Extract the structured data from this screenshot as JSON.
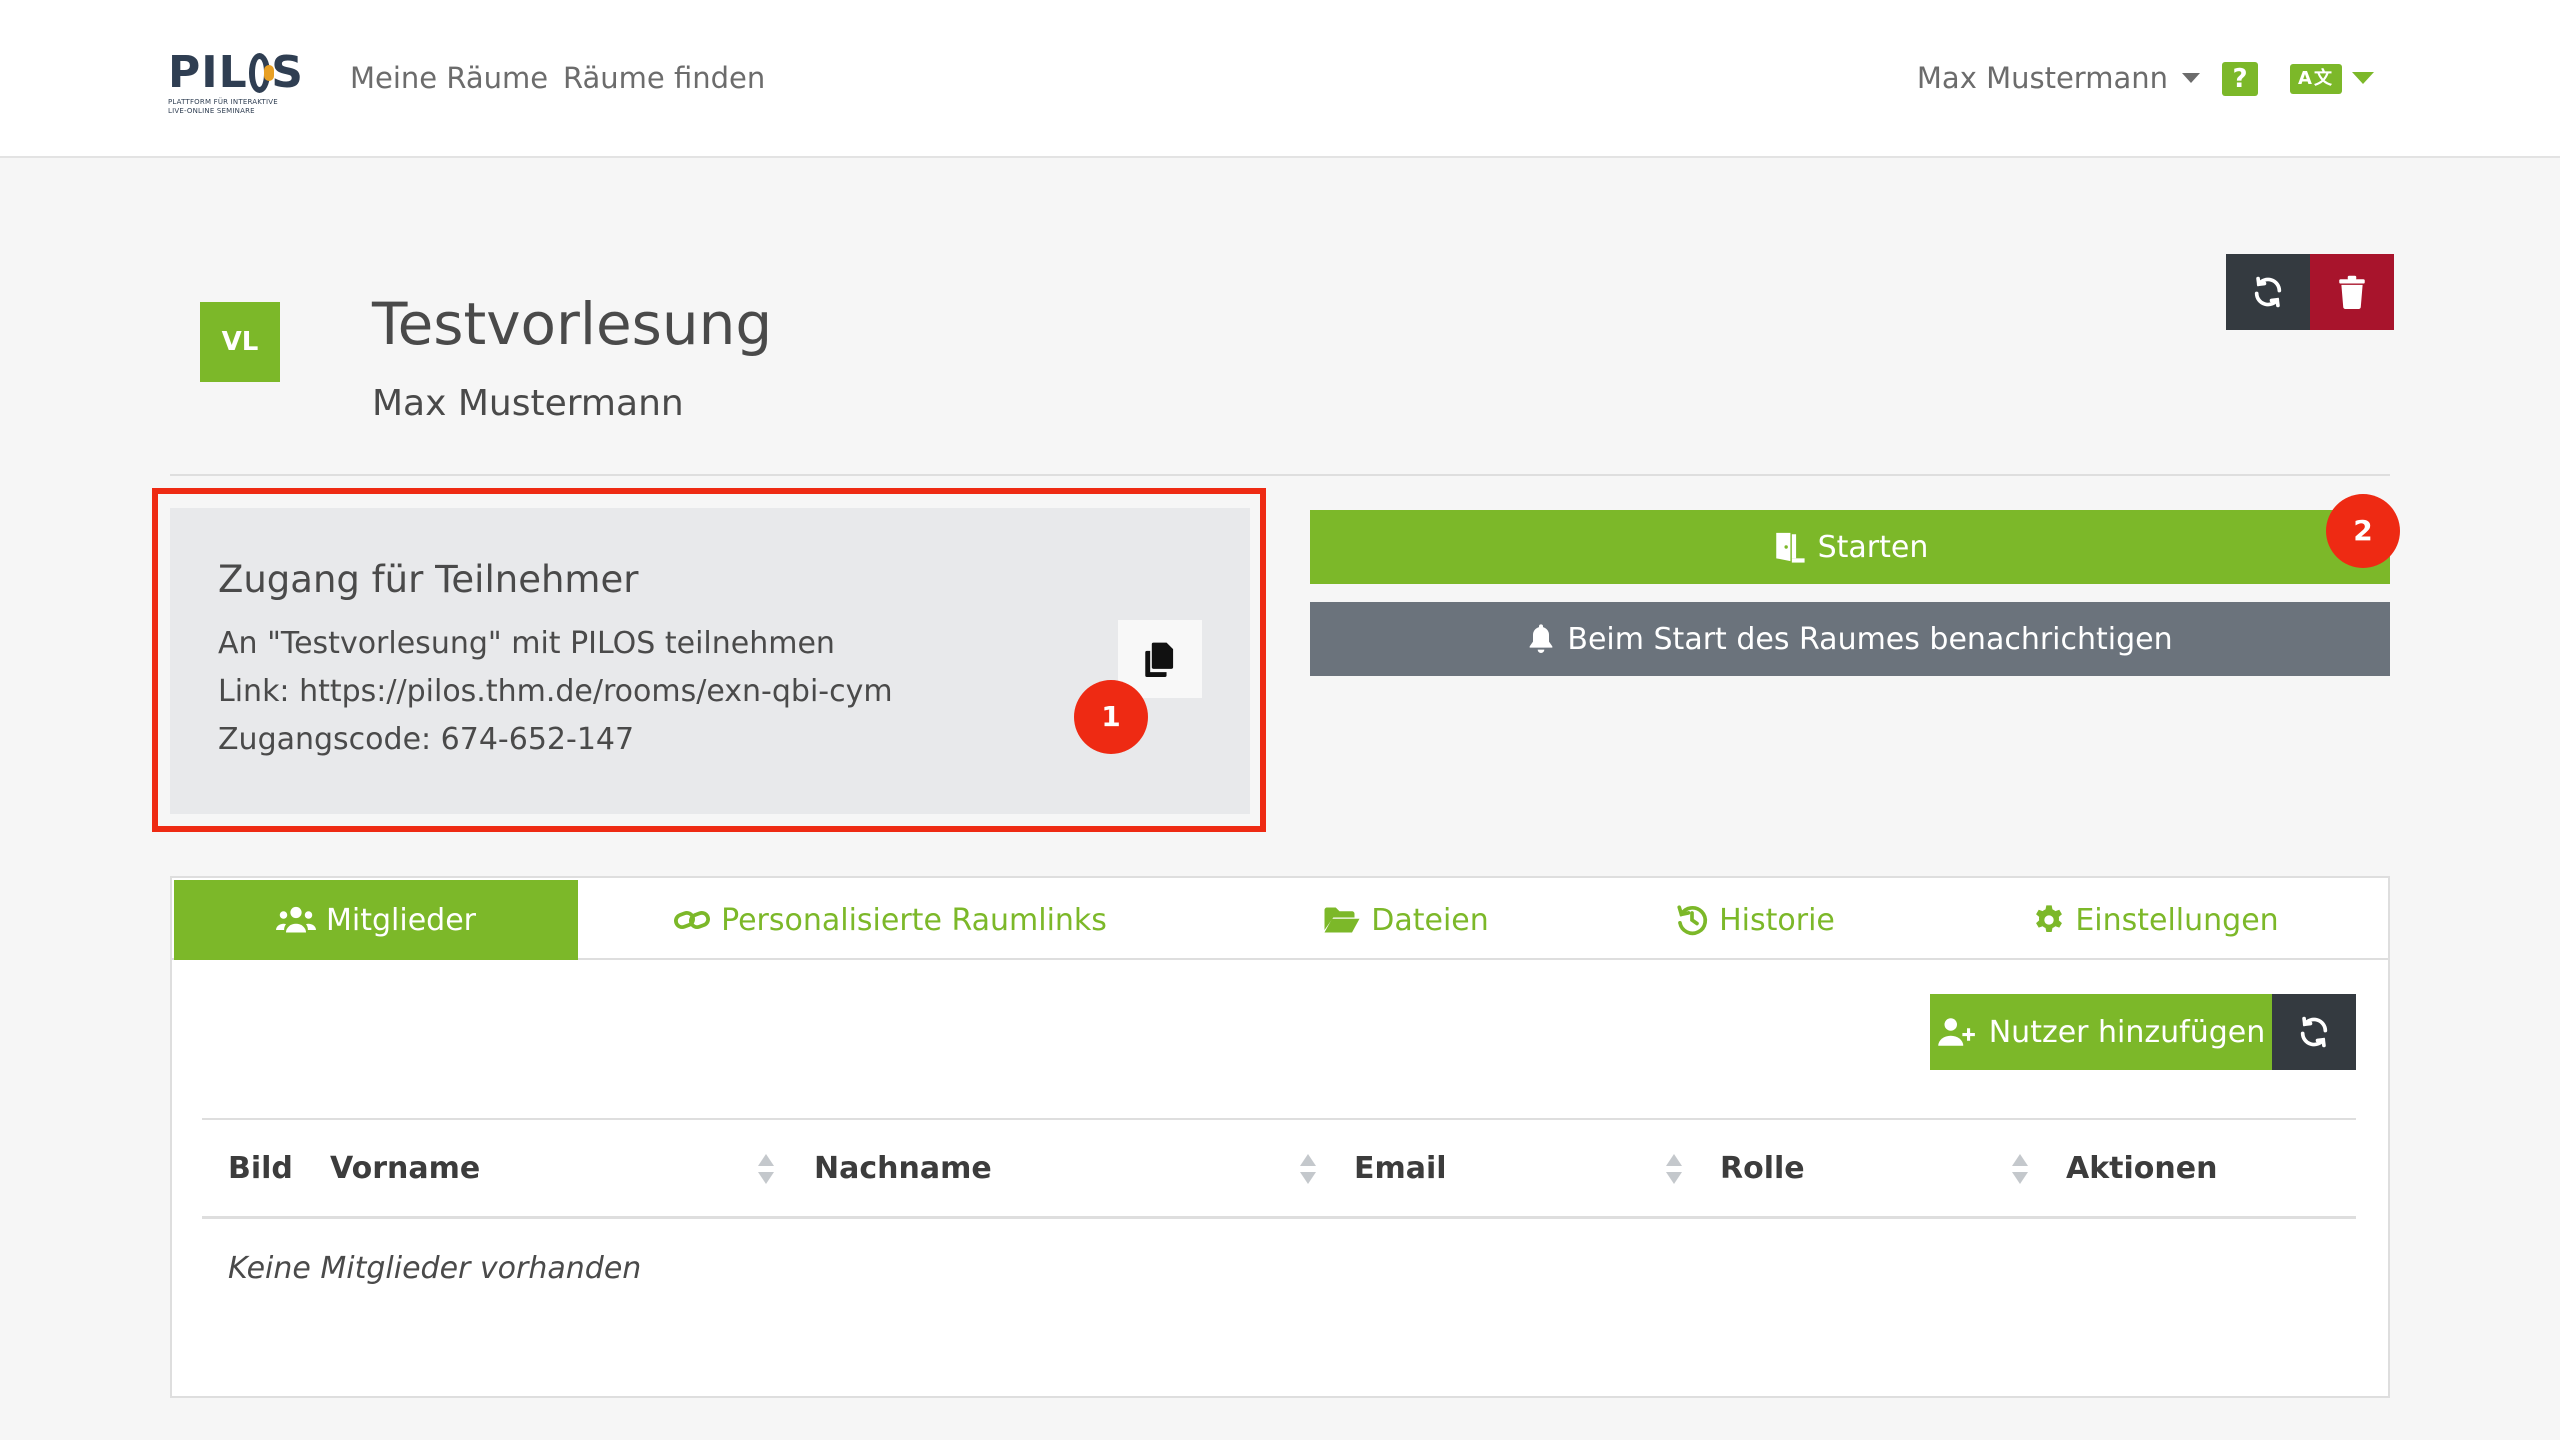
{
  "navbar": {
    "logo_text": "PILOS",
    "logo_subtitle_1": "PLATTFORM FÜR INTERAKTIVE",
    "logo_subtitle_2": "LIVE-ONLINE SEMINARE",
    "links": [
      "Meine Räume",
      "Räume finden"
    ],
    "user_name": "Max Mustermann",
    "help_label": "?",
    "language_label": "A文",
    "accent_color": "#7cb829"
  },
  "room": {
    "icon_label": "VL",
    "title": "Testvorlesung",
    "owner": "Max Mustermann",
    "header_buttons": [
      "reload-icon",
      "trash-icon"
    ]
  },
  "access": {
    "title": "Zugang für Teilnehmer",
    "line_1": "An \"Testvorlesung\" mit PILOS teilnehmen",
    "line_2": "Link: https://pilos.thm.de/rooms/exn-qbi-cym",
    "line_3": "Zugangscode: 674-652-147",
    "copy_icon": "copy-icon"
  },
  "markers": [
    "1",
    "2"
  ],
  "actions": {
    "start_label": "Starten",
    "notify_label": "Beim Start des Raumes benachrichtigen"
  },
  "tabs": [
    {
      "label": "Mitglieder",
      "icon": "users-icon",
      "active": true
    },
    {
      "label": "Personalisierte Raumlinks",
      "icon": "link-icon",
      "active": false
    },
    {
      "label": "Dateien",
      "icon": "folder-icon",
      "active": false
    },
    {
      "label": "Historie",
      "icon": "history-icon",
      "active": false
    },
    {
      "label": "Einstellungen",
      "icon": "gear-icon",
      "active": false
    }
  ],
  "members": {
    "add_user_label": "Nutzer hinzufügen",
    "columns": [
      "Bild",
      "Vorname",
      "Nachname",
      "Email",
      "Rolle",
      "Aktionen"
    ],
    "empty_message": "Keine Mitglieder vorhanden"
  },
  "colors": {
    "primary": "#7cb829",
    "dark": "#343a40",
    "danger": "#a8142c",
    "secondary": "#6b737c",
    "highlight": "#ee2a13"
  }
}
